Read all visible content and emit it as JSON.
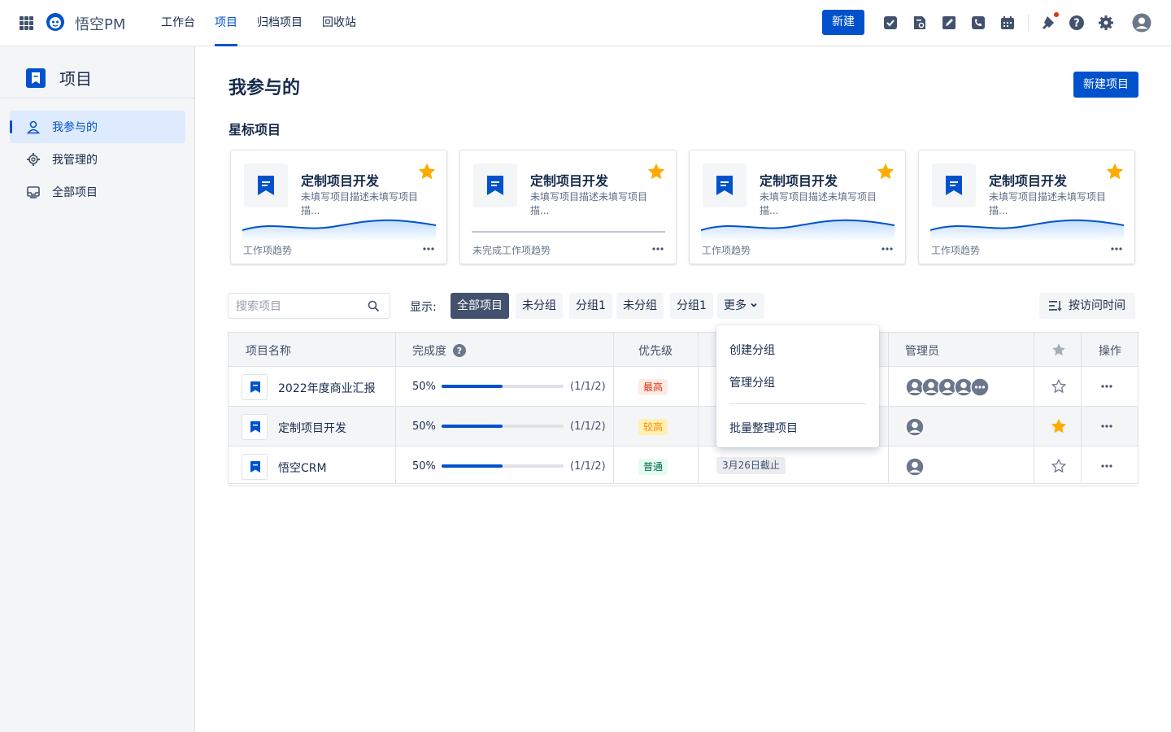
{
  "app": {
    "brand": "悟空PM"
  },
  "nav": {
    "items": [
      "工作台",
      "项目",
      "归档项目",
      "回收站"
    ],
    "active_index": 1
  },
  "toolbar": {
    "new_label": "新建",
    "accent_color": "#0052cc"
  },
  "sidebar": {
    "title": "项目",
    "items": [
      {
        "label": "我参与的",
        "icon": "user-icon",
        "active": true
      },
      {
        "label": "我管理的",
        "icon": "gear-icon",
        "active": false
      },
      {
        "label": "全部项目",
        "icon": "inbox-icon",
        "active": false
      }
    ]
  },
  "main": {
    "page_title": "我参与的",
    "new_project_label": "新建项目",
    "starred_title": "星标项目"
  },
  "cards": [
    {
      "title": "定制项目开发",
      "desc": "未填写项目描述未填写项目描...",
      "footer": "工作项趋势",
      "has_trend": true,
      "starred": true
    },
    {
      "title": "定制项目开发",
      "desc": "未填写项目描述未填写项目描...",
      "footer": "未完成工作项趋势",
      "has_trend": false,
      "starred": true
    },
    {
      "title": "定制项目开发",
      "desc": "未填写项目描述未填写项目描...",
      "footer": "工作项趋势",
      "has_trend": true,
      "starred": true
    },
    {
      "title": "定制项目开发",
      "desc": "未填写项目描述未填写项目描...",
      "footer": "工作项趋势",
      "has_trend": true,
      "starred": true
    }
  ],
  "filters": {
    "search_placeholder": "搜索项目",
    "show_label": "显示:",
    "chips": [
      "全部项目",
      "未分组",
      "分组1",
      "未分组",
      "分组1"
    ],
    "more_label": "更多",
    "sort_label": "按访问时间"
  },
  "table": {
    "headers": {
      "name": "项目名称",
      "progress": "完成度",
      "priority": "优先级",
      "admins": "管理员",
      "actions": "操作"
    },
    "rows": [
      {
        "name": "2022年度商业汇报",
        "percent": "50%",
        "progress": 0.5,
        "ratio": "(1/1/2)",
        "priority": "最高",
        "priority_color": "#de350b",
        "priority_bg": "#ffebe6",
        "due": "",
        "starred": false,
        "admin_count": 5
      },
      {
        "name": "定制项目开发",
        "percent": "50%",
        "progress": 0.5,
        "ratio": "(1/1/2)",
        "priority": "较高",
        "priority_color": "#ff8b00",
        "priority_bg": "#fff0b3",
        "due": "",
        "starred": true,
        "admin_count": 1
      },
      {
        "name": "悟空CRM",
        "percent": "50%",
        "progress": 0.5,
        "ratio": "(1/1/2)",
        "priority": "普通",
        "priority_color": "#006644",
        "priority_bg": "#e3fcef",
        "due": "3月26日截止",
        "starred": false,
        "admin_count": 1
      }
    ]
  },
  "dropdown": {
    "items": [
      "创建分组",
      "管理分组",
      "批量整理项目"
    ]
  }
}
